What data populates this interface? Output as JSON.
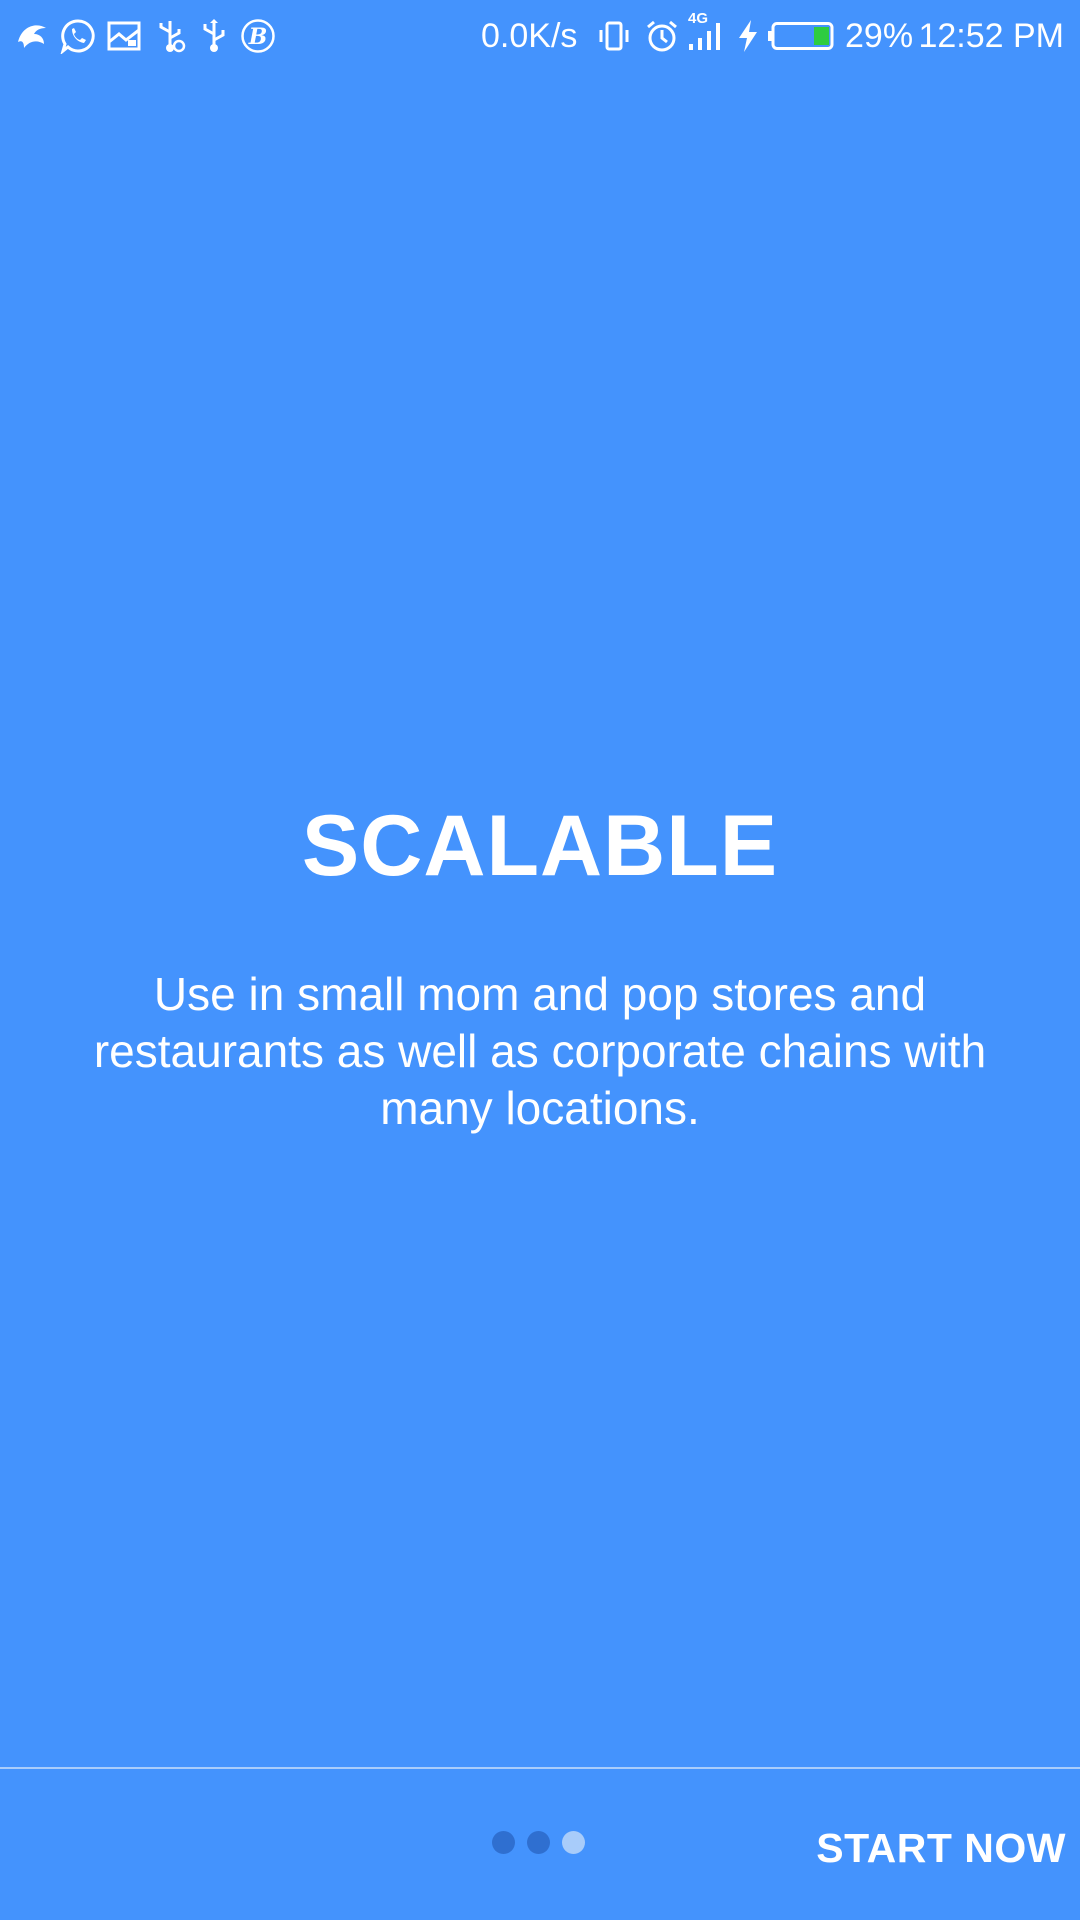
{
  "status_bar": {
    "icons_left": [
      "bird-app-icon",
      "whatsapp-icon",
      "gallery-icon",
      "usb-debug-icon",
      "usb-icon",
      "b-app-icon"
    ],
    "net_speed": "0.0K/s",
    "network_type": "4G",
    "battery_percent": "29%",
    "battery_level": 0.29,
    "time": "12:52 PM",
    "icons_right": [
      "vibrate-icon",
      "alarm-icon",
      "signal-icon",
      "charging-icon",
      "battery-icon"
    ]
  },
  "slide": {
    "title": "SCALABLE",
    "description": "Use in small mom and pop stores and restaurants as well as corporate chains with many locations."
  },
  "pager": {
    "total": 3,
    "current": 3
  },
  "bottom_bar": {
    "start_label": "START NOW"
  },
  "colors": {
    "background": "#4493fd",
    "text": "#ffffff",
    "dot_inactive": "#2f6fd0",
    "dot_active": "#a8ccfa",
    "battery_fill": "#2ecc40"
  }
}
